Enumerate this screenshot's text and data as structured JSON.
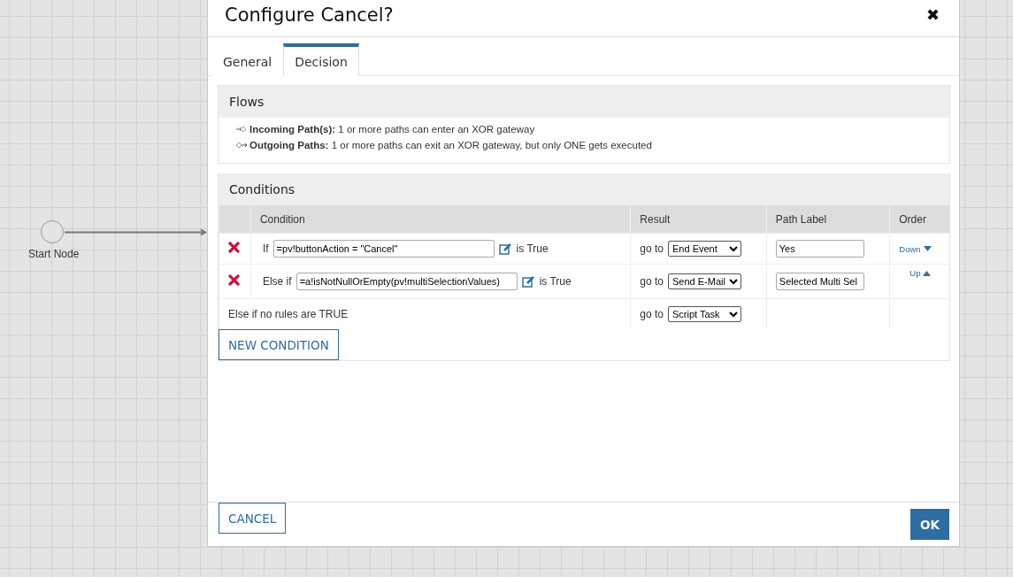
{
  "canvas": {
    "nodes": [
      {
        "kind": "start",
        "label": "Start Node"
      }
    ]
  },
  "dialog": {
    "title": "Configure Cancel?",
    "close": "✖",
    "tabs": [
      {
        "label": "General",
        "selected": false
      },
      {
        "label": "Decision",
        "selected": true
      }
    ],
    "flows": {
      "title": "Flows",
      "items": [
        {
          "kind": "incoming",
          "name": "Incoming Path(s):",
          "text": "1 or more paths can enter an XOR gateway"
        },
        {
          "kind": "outgoing",
          "name": "Outgoing Paths:",
          "text": "1 or more paths can exit an XOR gateway, but only ONE gets executed"
        }
      ]
    },
    "conditions": {
      "title": "Conditions",
      "columns": [
        "Condition",
        "Result",
        "Path Label",
        "Order"
      ],
      "rows": [
        {
          "kind": "rule",
          "keyword": "If",
          "expression": "=pv!buttonAction = \"Cancel\"",
          "suffix": "is True",
          "goto": "go to",
          "result": "End Event",
          "path_label": "Yes",
          "order": {
            "label": "Down",
            "kind": "down"
          }
        },
        {
          "kind": "rule",
          "keyword": "Else if",
          "expression": "=a!isNotNullOrEmpty(pv!multiSelectionValues)",
          "suffix": "is True",
          "goto": "go to",
          "result": "Send E-Mail",
          "path_label": "Selected Multi Sel",
          "order": {
            "label": "Up",
            "kind": "up"
          }
        },
        {
          "kind": "default",
          "text": "Else if no rules are TRUE",
          "goto": "go to",
          "result": "Script Task"
        }
      ],
      "new_button": "NEW CONDITION"
    },
    "buttons": {
      "cancel": "CANCEL",
      "ok": "OK"
    }
  }
}
